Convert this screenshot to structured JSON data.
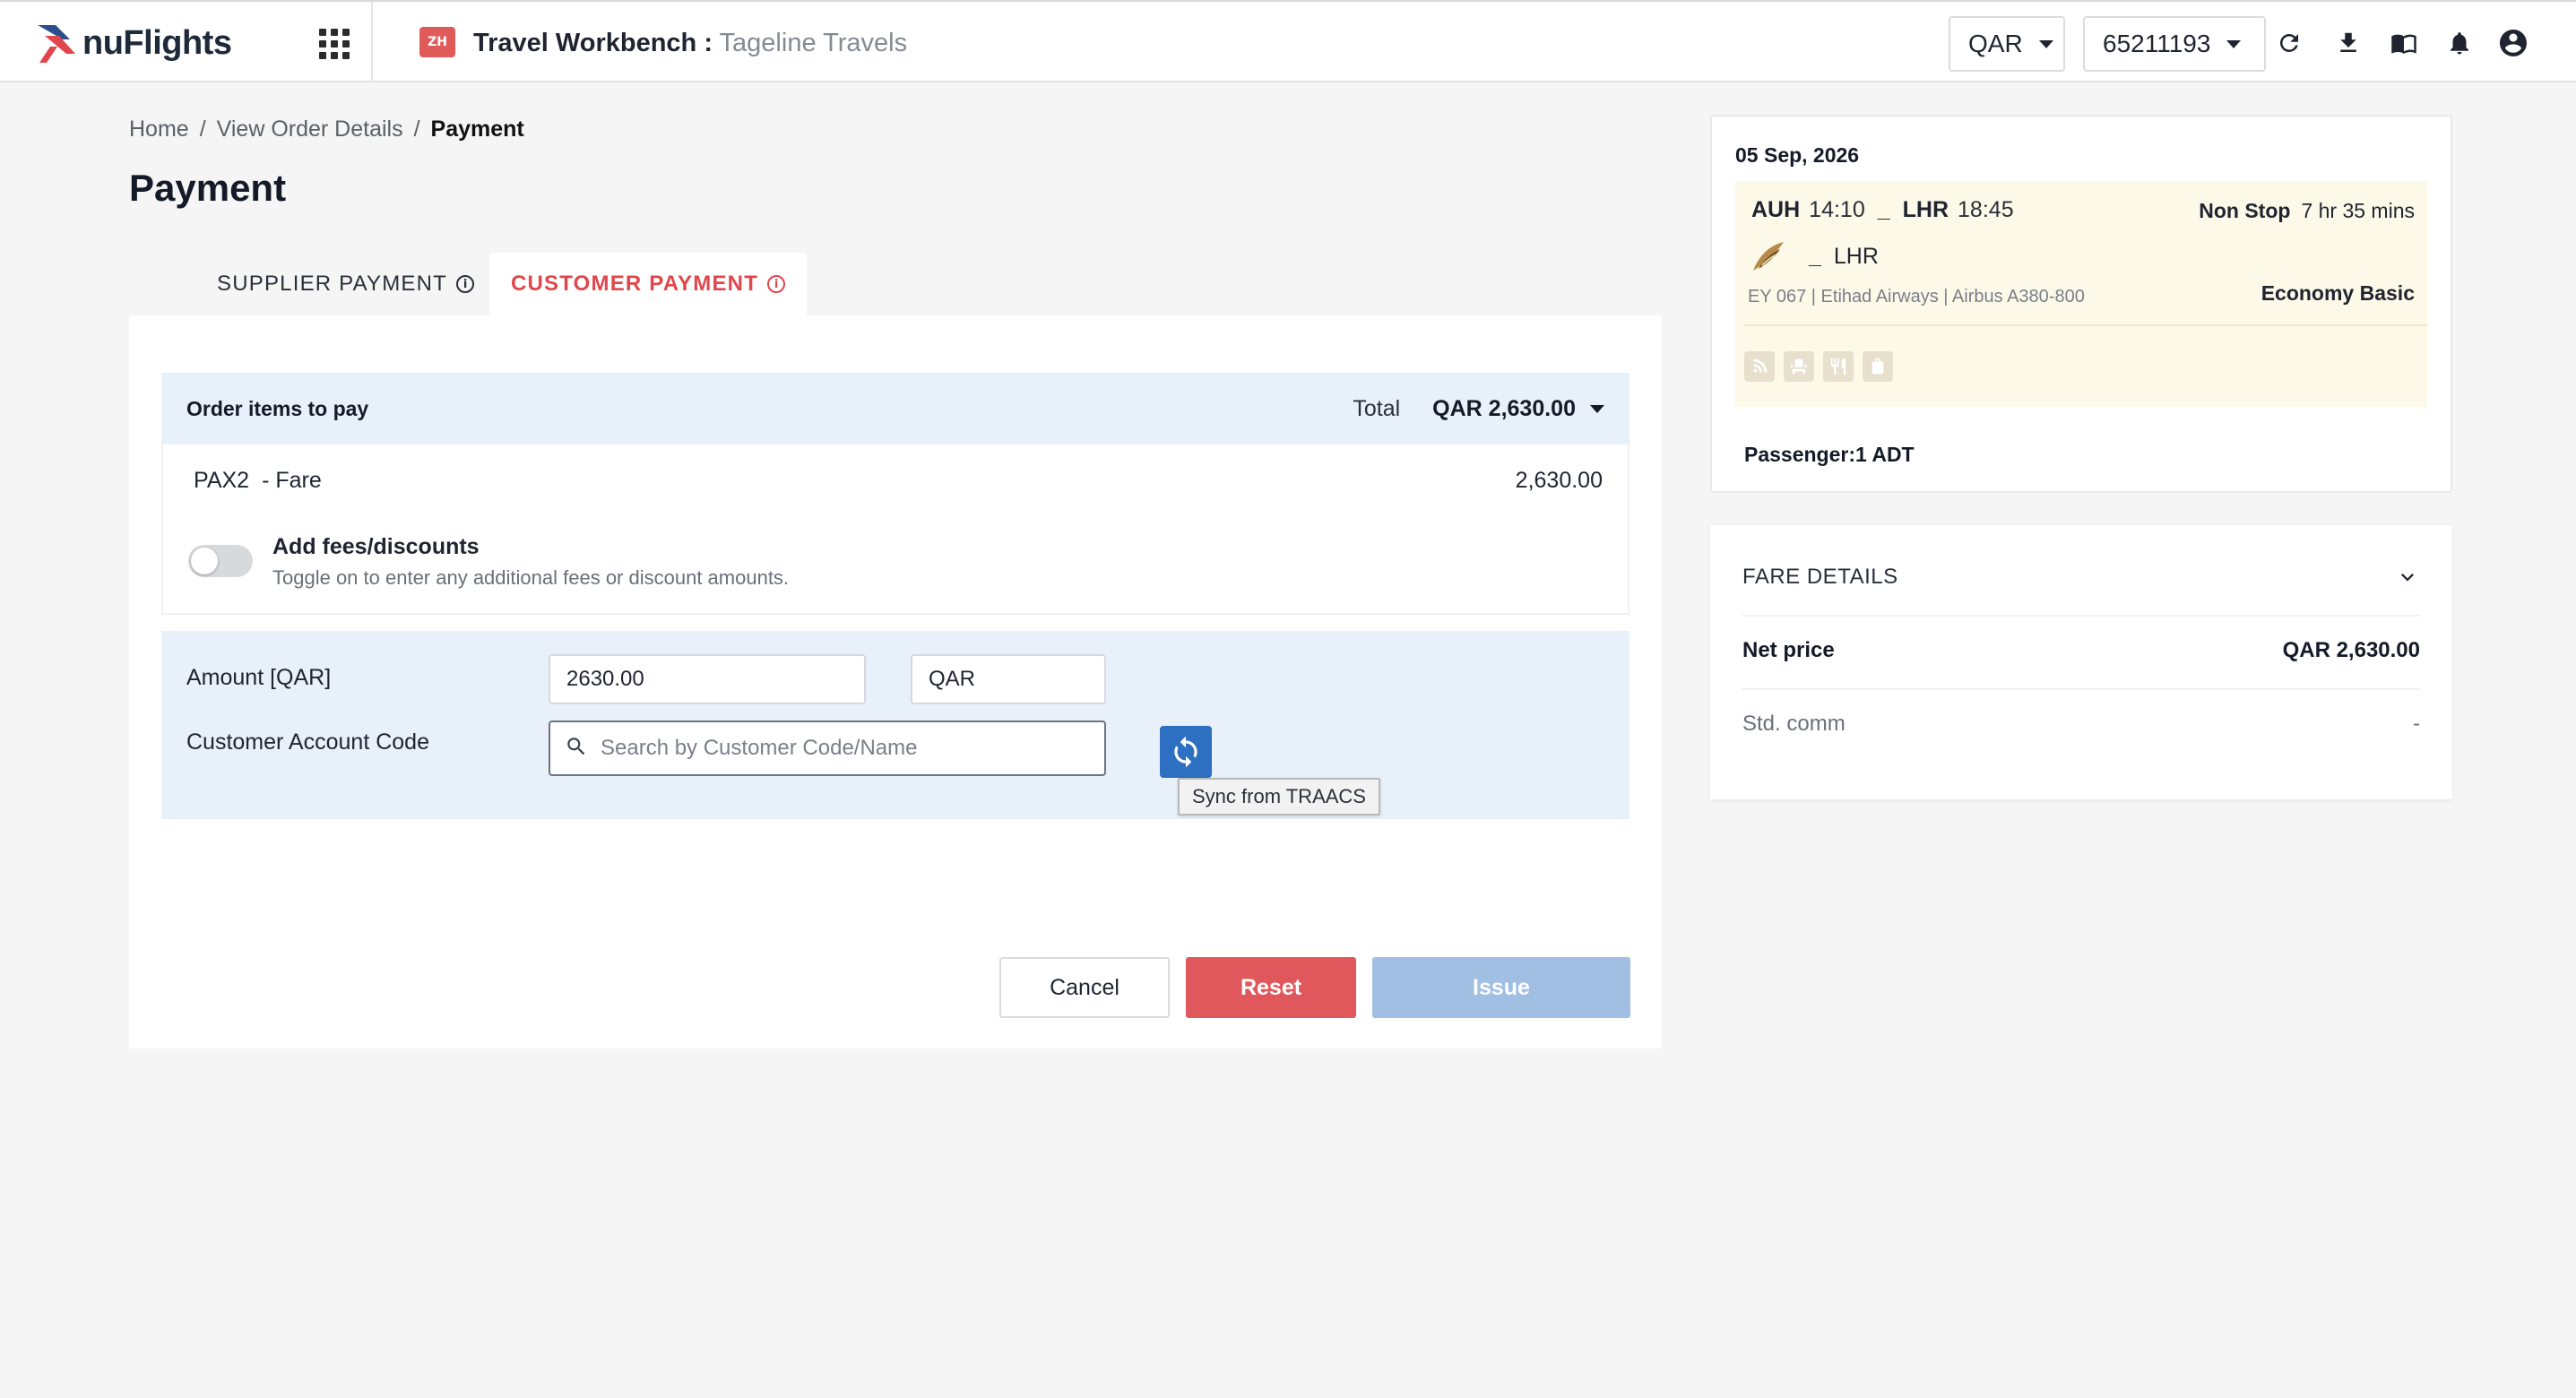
{
  "header": {
    "logo_text": "nuFlights",
    "app_badge": "ZH",
    "app_title": "Travel Workbench :",
    "app_subtitle": "Tageline Travels",
    "currency": "QAR",
    "account": "65211193"
  },
  "breadcrumb": {
    "items": [
      "Home",
      "View Order Details"
    ],
    "current": "Payment"
  },
  "page_title": "Payment",
  "tabs": [
    {
      "label": "SUPPLIER PAYMENT",
      "active": false
    },
    {
      "label": "CUSTOMER PAYMENT",
      "active": true
    }
  ],
  "order": {
    "label": "Order items to pay",
    "total_label": "Total",
    "total_value": "QAR 2,630.00",
    "pax": "PAX2",
    "item": "- Fare",
    "amount": "2,630.00",
    "fees_title": "Add fees/discounts",
    "fees_help": "Toggle on to enter any additional fees or discount amounts."
  },
  "payment": {
    "amount_label": "Amount [QAR]",
    "amount_value": "2630.00",
    "currency_value": "QAR",
    "account_label": "Customer Account Code",
    "account_placeholder": "Search by Customer Code/Name",
    "sync_tooltip": "Sync from TRAACS"
  },
  "actions": {
    "cancel": "Cancel",
    "reset": "Reset",
    "issue": "Issue"
  },
  "flight": {
    "date": "05 Sep, 2026",
    "origin": "AUH",
    "dep_time": "14:10",
    "dest": "LHR",
    "arr_time": "18:45",
    "stops": "Non Stop",
    "duration": "7 hr 35 mins",
    "dest_line": "LHR",
    "flight_info": "EY 067 | Etihad Airways | Airbus A380-800",
    "cabin": "Economy Basic",
    "passenger": "Passenger:1 ADT"
  },
  "fare_details": {
    "title": "FARE DETAILS",
    "net_label": "Net price",
    "net_value": "QAR 2,630.00",
    "comm_label": "Std. comm",
    "comm_value": "-"
  },
  "colors": {
    "brand_red": "#e0474c",
    "primary_blue": "#2d6fc0",
    "panel_blue": "#e8f0fa"
  }
}
